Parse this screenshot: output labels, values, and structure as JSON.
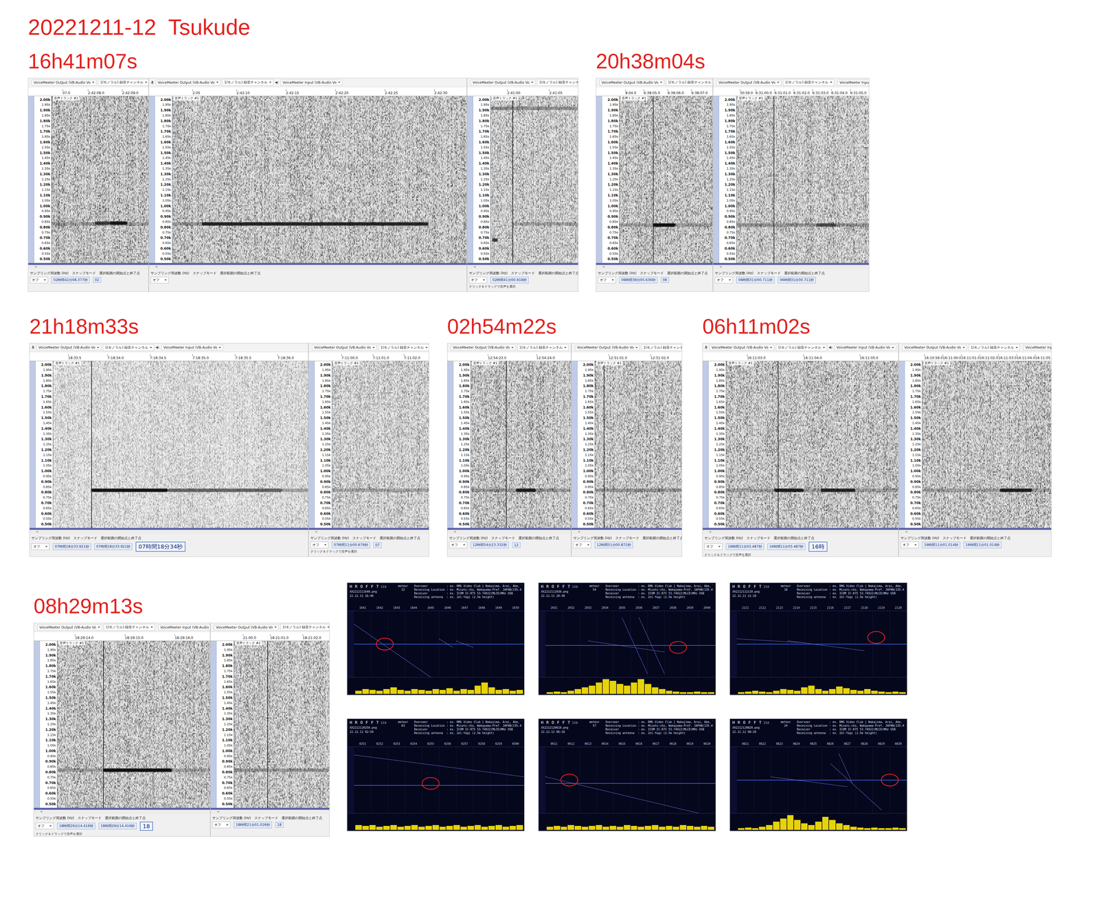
{
  "title": "20221211-12  Tsukude",
  "audacity": {
    "toolbar": [
      "VoiceMeeter Output (VB-Audio Vo",
      "1(モノラル) 録音チャンネル",
      "VoiceMeeter Input (VB-Audio Vo"
    ],
    "track": "音声トラック #1",
    "scroll": "<",
    "footer_labels": [
      "サンプリング周波数 (Hz)",
      "スナップモード",
      "選択範囲の開始点と終了点"
    ],
    "snap": "オフ"
  },
  "freq_axis": [
    "2.00k",
    "1.95k",
    "1.90k",
    "1.85k",
    "1.80k",
    "1.75k",
    "1.70k",
    "1.65k",
    "1.60k",
    "1.55k",
    "1.50k",
    "1.45k",
    "1.40k",
    "1.35k",
    "1.30k",
    "1.25k",
    "1.20k",
    "1.15k",
    "1.10k",
    "1.05k",
    "1.00k",
    "0.95k",
    "0.90k",
    "0.85k",
    "0.80k",
    "0.75k",
    "0.70k",
    "0.65k",
    "0.60k",
    "0.55k",
    "0.50k"
  ],
  "events": [
    {
      "time": "16h41m07s",
      "shots": [
        {
          "ruler": [
            "07.0",
            "2:42:08.0",
            "2:42:09.0"
          ],
          "noise": 0.62,
          "cursor": null,
          "echoes": [
            [
              0.0,
              1.0,
              0.83,
              0.25
            ],
            [
              0.45,
              0.6,
              0.84,
              0.7
            ],
            [
              0.6,
              0.78,
              0.84,
              0.95
            ]
          ],
          "fields": [
            {
              "text": "02時間42分08.377秒",
              "kind": "field"
            },
            {
              "text": "02",
              "kind": "field"
            }
          ],
          "status": ""
        },
        {
          "ruler": [
            "2:05",
            "2:42:10",
            "2:42:15",
            "2:42:20",
            "2:42:25",
            "2:42:30"
          ],
          "noise": 0.6,
          "cursor": null,
          "echoes": [
            [
              0.0,
              0.1,
              0.83,
              0.3
            ],
            [
              0.1,
              0.87,
              0.83,
              0.9
            ]
          ],
          "fields": [],
          "status": ""
        },
        {
          "ruler": [
            "2:41:00",
            "2:41:05"
          ],
          "noise": 0.55,
          "cursor": 0.25,
          "echoes": [
            [
              0.0,
              1.0,
              1.92,
              0.35
            ],
            [
              0.02,
              0.08,
              0.68,
              0.8
            ],
            [
              0.25,
              1.0,
              0.83,
              0.25
            ]
          ],
          "fields": [
            {
              "text": "02時間41分00.918秒",
              "kind": "field"
            }
          ],
          "status": "クリック＆ドラッグで音声を選択"
        }
      ]
    },
    {
      "time": "20h38m04s",
      "shots": [
        {
          "ruler": [
            "8:04.0",
            "6:38:05.0",
            "6:38:06.0",
            "6:38:07.0"
          ],
          "noise": 0.6,
          "cursor": 0.36,
          "echoes": [
            [
              0.0,
              1.0,
              0.82,
              0.25
            ],
            [
              0.36,
              0.6,
              0.82,
              1.0
            ]
          ],
          "fields": [
            {
              "text": "06時間38分05.636秒",
              "kind": "field"
            },
            {
              "text": "06",
              "kind": "field"
            }
          ],
          "status": ""
        },
        {
          "ruler": [
            "30:59.0",
            "6:31:00.0",
            "6:31:01.0",
            "6:31:02.0",
            "6:31:03.0",
            "6:31:04.0",
            "6:31:05.0"
          ],
          "noise": 0.58,
          "cursor": 0.28,
          "echoes": [
            [
              0.0,
              1.0,
              0.82,
              0.3
            ],
            [
              0.6,
              0.75,
              0.82,
              0.55
            ]
          ],
          "fields": [
            {
              "text": "06時間31分00.711秒",
              "kind": "field"
            },
            {
              "text": "06時間31分00.711秒",
              "kind": "field"
            }
          ],
          "status": ""
        }
      ]
    },
    {
      "time": "21h18m33s",
      "shots": [
        {
          "ruler": [
            "18:33.5",
            "7:18:34.0",
            "7:18:34.5",
            "7:18:35.0",
            "7:18:35.5",
            "7:18:36.0"
          ],
          "noise": 0.38,
          "cursor": 0.15,
          "echoes": [
            [
              0.15,
              0.45,
              0.82,
              1.0
            ],
            [
              0.45,
              0.9,
              0.82,
              0.6
            ],
            [
              0.9,
              1.0,
              0.82,
              0.3
            ]
          ],
          "fields": [
            {
              "text": "07時間18分33.921秒",
              "kind": "field"
            },
            {
              "text": "07時間18分33.921秒",
              "kind": "field"
            },
            {
              "text": "07時間18分34秒",
              "kind": "big"
            }
          ],
          "status": ""
        },
        {
          "ruler": [
            "7:11:00.0",
            "7:11:01.0",
            "7:11:02.0"
          ],
          "noise": 0.5,
          "cursor": null,
          "echoes": [
            [
              0.0,
              1.0,
              0.82,
              0.25
            ]
          ],
          "fields": [
            {
              "text": "07時間11分00.679秒",
              "kind": "field"
            },
            {
              "text": "07",
              "kind": "field"
            }
          ],
          "status": "クリック＆ドラッグで音声を選択"
        }
      ]
    },
    {
      "time": "02h54m22s",
      "shots": [
        {
          "ruler": [
            "12:54:23.0",
            "12:54:24.0"
          ],
          "noise": 0.6,
          "cursor": 0.35,
          "echoes": [
            [
              0.0,
              1.0,
              0.82,
              0.3
            ],
            [
              0.45,
              0.65,
              0.82,
              0.9
            ]
          ],
          "fields": [
            {
              "text": "12時間54分23.332秒",
              "kind": "field"
            },
            {
              "text": "12",
              "kind": "field"
            }
          ],
          "status": ""
        },
        {
          "ruler": [
            "12:51:01.0",
            "12:51:02.0"
          ],
          "noise": 0.58,
          "cursor": 0.1,
          "echoes": [
            [
              0.0,
              1.0,
              0.82,
              0.3
            ]
          ],
          "fields": [
            {
              "text": "12時間51分00.872秒",
              "kind": "field"
            }
          ],
          "status": ""
        }
      ]
    },
    {
      "time": "06h11m02s",
      "shots": [
        {
          "ruler": [
            "16:11:03.0",
            "16:11:04.0",
            "16:11:05.0"
          ],
          "noise": 0.6,
          "cursor": 0.3,
          "echoes": [
            [
              0.0,
              1.0,
              0.82,
              0.25
            ],
            [
              0.28,
              0.45,
              0.82,
              0.9
            ],
            [
              0.55,
              0.75,
              0.82,
              0.85
            ]
          ],
          "fields": [
            {
              "text": "16時間11分03.487秒",
              "kind": "field"
            },
            {
              "text": "16時間11分03.487秒",
              "kind": "field"
            },
            {
              "text": "16時",
              "kind": "big"
            }
          ],
          "status": "クリック＆ドラッグで音声を選択"
        },
        {
          "ruler": [
            "16:10:59.0",
            "16:11:00.0",
            "16:11:01.0",
            "16:11:02.0",
            "16:11:03.0",
            "16:11:04.0",
            "16:11:05.0"
          ],
          "noise": 0.6,
          "cursor": null,
          "echoes": [
            [
              0.0,
              1.0,
              0.82,
              0.25
            ],
            [
              0.6,
              0.85,
              0.82,
              0.9
            ]
          ],
          "fields": [
            {
              "text": "16時間11分01.014秒",
              "kind": "field"
            },
            {
              "text": "16時間11分01.014秒",
              "kind": "field"
            }
          ],
          "status": ""
        }
      ]
    },
    {
      "time": "08h29m13s",
      "shots": [
        {
          "ruler": [
            "18:29:14.0",
            "18:29:15.0",
            "18:29:16.0"
          ],
          "noise": 0.6,
          "cursor": 0.3,
          "echoes": [
            [
              0.0,
              1.0,
              0.82,
              0.25
            ],
            [
              0.3,
              0.75,
              0.82,
              1.0
            ]
          ],
          "fields": [
            {
              "text": "18時間29分14.416秒",
              "kind": "field"
            },
            {
              "text": "18時間29分14.416秒",
              "kind": "field"
            },
            {
              "text": "18",
              "kind": "big"
            }
          ],
          "status": "クリック＆ドラッグで音声を選択"
        },
        {
          "ruler": [
            "21:00.0",
            "18:21:01.0",
            "18:21:02.0"
          ],
          "noise": 0.58,
          "cursor": 0.35,
          "echoes": [
            [
              0.0,
              1.0,
              0.82,
              0.3
            ]
          ],
          "fields": [
            {
              "text": "18時間21分01.026秒",
              "kind": "field"
            },
            {
              "text": "18",
              "kind": "field"
            }
          ],
          "status": ""
        }
      ]
    }
  ],
  "hrofft_info": [
    "Overveer           : ex. RMG Video Club [ Nakajima, Arai, Abe, Toyomasu ]",
    "Receiving Location : ex. Misato-cho, Wakayama-Pref. JAPAN(135.41E, 34.14N)",
    "Receiver           : ex. ICOM IC-R75 53.74922(MLCD)MHz USB",
    "Receiving antenna  : ex. 2el-Yagi (2.5m height)"
  ],
  "hrofft": [
    {
      "app": "H R O F F T",
      "version": "150",
      "file": "XX2212111640.png",
      "date": "22.12.11 16:40",
      "meteor": "meteor",
      "count": "22",
      "times": [
        "1641",
        "1642",
        "1643",
        "1644",
        "1645",
        "1646",
        "1647",
        "1648",
        "1649",
        "1650"
      ],
      "carrier": 0.5,
      "trails": [
        [
          0.0,
          0.2,
          0.45,
          1.0
        ],
        [
          0.5,
          0.42,
          0.58,
          0.55
        ],
        [
          0.6,
          0.45,
          0.7,
          0.55
        ]
      ],
      "circle": [
        0.18,
        0.5
      ],
      "hist": [
        0.2,
        0.3,
        0.25,
        0.2,
        0.3,
        0.4,
        0.25,
        0.2,
        0.3,
        0.25,
        0.2,
        0.3,
        0.25,
        0.35,
        0.2,
        0.3,
        0.25,
        0.5,
        0.7,
        0.4,
        0.25,
        0.3,
        0.2,
        0.25
      ]
    },
    {
      "app": "H R O F F T",
      "version": "150",
      "file": "XX2212112030.png",
      "date": "22.12.11 20:30",
      "meteor": "meteor",
      "count": "54",
      "times": [
        "2031",
        "2032",
        "2033",
        "2034",
        "2035",
        "2036",
        "2037",
        "2038",
        "2039",
        "2040"
      ],
      "carrier": 0.52,
      "trails": [
        [
          0.25,
          0.45,
          0.7,
          0.62
        ],
        [
          0.45,
          0.1,
          0.6,
          0.95
        ],
        [
          0.55,
          0.1,
          0.7,
          0.95
        ]
      ],
      "circle": [
        0.78,
        0.55
      ],
      "hist": [
        0.1,
        0.15,
        0.1,
        0.2,
        0.3,
        0.4,
        0.5,
        0.7,
        0.9,
        0.8,
        0.6,
        0.5,
        0.7,
        0.9,
        0.6,
        0.4,
        0.3,
        0.2,
        0.15,
        0.1,
        0.1,
        0.15,
        0.1,
        0.1
      ]
    },
    {
      "app": "H R O F F T",
      "version": "150",
      "file": "XX2212112110.png",
      "date": "22.12.11 21:10",
      "meteor": "meteor",
      "count": "18",
      "times": [
        "2111",
        "2112",
        "2113",
        "2114",
        "2115",
        "2116",
        "2117",
        "2118",
        "2119",
        "2120"
      ],
      "carrier": 0.5,
      "trails": [
        [
          0.3,
          0.45,
          0.75,
          0.6
        ],
        [
          0.0,
          0.42,
          0.4,
          0.48
        ]
      ],
      "circle": [
        0.82,
        0.4
      ],
      "hist": [
        0.1,
        0.15,
        0.2,
        0.15,
        0.1,
        0.2,
        0.3,
        0.25,
        0.2,
        0.4,
        0.5,
        0.3,
        0.2,
        0.3,
        0.45,
        0.35,
        0.25,
        0.2,
        0.3,
        0.2,
        0.15,
        0.1,
        0.15,
        0.1
      ]
    },
    {
      "app": "H R O F F T",
      "version": "150",
      "file": "XX2212120250.png",
      "date": "22.12.12 02:50",
      "meteor": "meteor",
      "count": "63",
      "times": [
        "0251",
        "0252",
        "0253",
        "0254",
        "0255",
        "0256",
        "0257",
        "0258",
        "0259",
        "0300"
      ],
      "carrier": 0.58,
      "trails": [
        [
          0.0,
          0.12,
          1.0,
          0.45
        ]
      ],
      "circle": [
        0.45,
        0.55
      ],
      "hist": [
        0.3,
        0.25,
        0.3,
        0.2,
        0.25,
        0.3,
        0.2,
        0.25,
        0.3,
        0.2,
        0.25,
        0.3,
        0.2,
        0.25,
        0.3,
        0.2,
        0.25,
        0.3,
        0.2,
        0.25,
        0.3,
        0.2,
        0.25,
        0.3
      ]
    },
    {
      "app": "H R O F F T",
      "version": "150",
      "file": "XX2212120610.png",
      "date": "22.12.12 06:10",
      "meteor": "meteor",
      "count": "57",
      "times": [
        "0611",
        "0612",
        "0613",
        "0614",
        "0615",
        "0616",
        "0617",
        "0618",
        "0619",
        "0620"
      ],
      "carrier": 0.55,
      "trails": [
        [
          0.0,
          0.45,
          0.9,
          1.0
        ]
      ],
      "circle": [
        0.14,
        0.5
      ],
      "hist": [
        0.2,
        0.25,
        0.2,
        0.3,
        0.25,
        0.2,
        0.25,
        0.3,
        0.2,
        0.25,
        0.2,
        0.3,
        0.25,
        0.2,
        0.25,
        0.3,
        0.2,
        0.25,
        0.2,
        0.3,
        0.25,
        0.2,
        0.25,
        0.2
      ]
    },
    {
      "app": "H R O F F T",
      "version": "150",
      "file": "XX2212120820.png",
      "date": "22.12.12 08:20",
      "meteor": "meteor",
      "count": "24",
      "times": [
        "0821",
        "0822",
        "0823",
        "0824",
        "0825",
        "0826",
        "0827",
        "0828",
        "0829",
        "0830"
      ],
      "carrier": 0.5,
      "trails": [
        [
          0.2,
          0.45,
          0.65,
          0.6
        ],
        [
          0.55,
          0.25,
          0.85,
          0.95
        ],
        [
          0.6,
          0.1,
          0.68,
          0.55
        ]
      ],
      "circle": [
        0.9,
        0.5
      ],
      "hist": [
        0.1,
        0.15,
        0.1,
        0.2,
        0.3,
        0.5,
        0.7,
        0.9,
        0.6,
        0.4,
        0.3,
        0.5,
        0.8,
        0.6,
        0.4,
        0.3,
        0.2,
        0.15,
        0.1,
        0.15,
        0.1,
        0.1,
        0.15,
        0.1
      ]
    }
  ]
}
